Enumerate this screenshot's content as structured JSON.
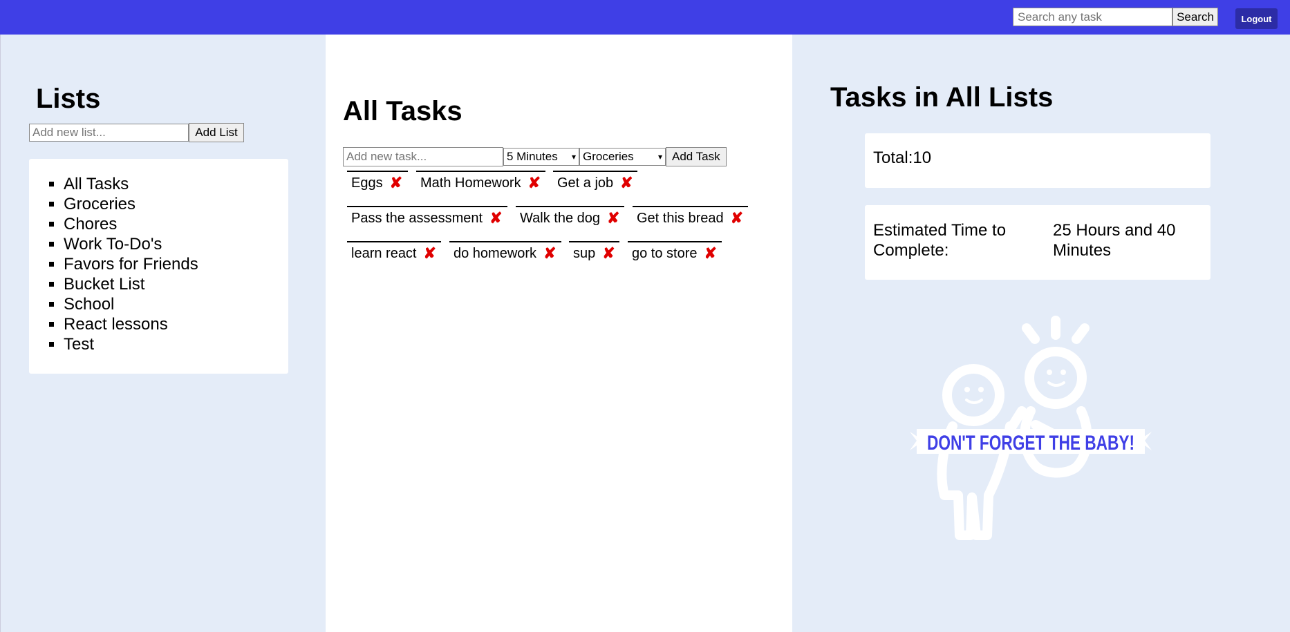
{
  "header": {
    "search_placeholder": "Search any task",
    "search_label": "Search",
    "logout_label": "Logout"
  },
  "sidebar": {
    "title": "Lists",
    "input_placeholder": "Add new list...",
    "add_label": "Add List",
    "items": [
      {
        "label": "All Tasks"
      },
      {
        "label": "Groceries"
      },
      {
        "label": "Chores"
      },
      {
        "label": "Work To-Do's"
      },
      {
        "label": "Favors for Friends"
      },
      {
        "label": "Bucket List"
      },
      {
        "label": "School"
      },
      {
        "label": "React lessons"
      },
      {
        "label": "Test"
      }
    ]
  },
  "main": {
    "title": "All Tasks",
    "input_placeholder": "Add new task...",
    "time_selected": "5 Minutes",
    "list_selected": "Groceries",
    "add_label": "Add Task",
    "delete_glyph": "✘",
    "tasks": [
      {
        "label": "Eggs"
      },
      {
        "label": "Math Homework"
      },
      {
        "label": "Get a job"
      },
      {
        "label": "Pass the assessment"
      },
      {
        "label": "Walk the dog"
      },
      {
        "label": "Get this bread"
      },
      {
        "label": "learn react"
      },
      {
        "label": "do homework"
      },
      {
        "label": "sup"
      },
      {
        "label": "go to store"
      }
    ]
  },
  "summary": {
    "title": "Tasks in All Lists",
    "total_label": "Total:10",
    "time_label": "Estimated Time to Complete:",
    "time_value": "25 Hours and 40 Minutes",
    "banner_text": "DON'T FORGET THE BABY!"
  },
  "colors": {
    "topbar": "#3f3fe6",
    "logout": "#2c2ca6",
    "delete": "#e00000",
    "panel": "#e4ecf8",
    "banner_text": "#3f3fe6"
  }
}
